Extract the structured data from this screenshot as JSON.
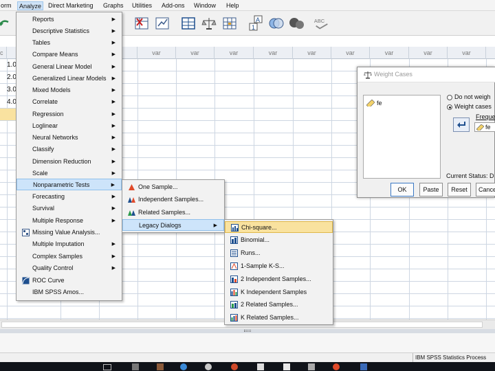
{
  "menubar": {
    "items": [
      "orm",
      "Analyze",
      "Direct Marketing",
      "Graphs",
      "Utilities",
      "Add-ons",
      "Window",
      "Help"
    ]
  },
  "grid": {
    "columns": [
      "c",
      "",
      "",
      "var",
      "var",
      "var",
      "var",
      "var",
      "var",
      "var",
      "var",
      "var",
      "var"
    ],
    "values": [
      "1.0",
      "2.0",
      "3.0",
      "4.0"
    ]
  },
  "analyze_menu": {
    "items": [
      {
        "label": "Reports",
        "arrow": true
      },
      {
        "label": "Descriptive Statistics",
        "arrow": true
      },
      {
        "label": "Tables",
        "arrow": true
      },
      {
        "label": "Compare Means",
        "arrow": true
      },
      {
        "label": "General Linear Model",
        "arrow": true
      },
      {
        "label": "Generalized Linear Models",
        "arrow": true
      },
      {
        "label": "Mixed Models",
        "arrow": true
      },
      {
        "label": "Correlate",
        "arrow": true
      },
      {
        "label": "Regression",
        "arrow": true
      },
      {
        "label": "Loglinear",
        "arrow": true
      },
      {
        "label": "Neural Networks",
        "arrow": true
      },
      {
        "label": "Classify",
        "arrow": true
      },
      {
        "label": "Dimension Reduction",
        "arrow": true
      },
      {
        "label": "Scale",
        "arrow": true
      },
      {
        "label": "Nonparametric Tests",
        "arrow": true
      },
      {
        "label": "Forecasting",
        "arrow": true
      },
      {
        "label": "Survival",
        "arrow": true
      },
      {
        "label": "Multiple Response",
        "arrow": true
      },
      {
        "label": "Missing Value Analysis...",
        "arrow": false
      },
      {
        "label": "Multiple Imputation",
        "arrow": true
      },
      {
        "label": "Complex Samples",
        "arrow": true
      },
      {
        "label": "Quality Control",
        "arrow": true
      },
      {
        "label": "ROC Curve",
        "arrow": false
      },
      {
        "label": "IBM SPSS Amos...",
        "arrow": false
      }
    ]
  },
  "nonparametric_menu": {
    "items": [
      {
        "label": "One Sample...",
        "arrow": false
      },
      {
        "label": "Independent Samples...",
        "arrow": false
      },
      {
        "label": "Related Samples...",
        "arrow": false
      },
      {
        "label": "Legacy Dialogs",
        "arrow": true
      }
    ]
  },
  "legacy_menu": {
    "items": [
      "Chi-square...",
      "Binomial...",
      "Runs...",
      "1-Sample K-S...",
      "2 Independent Samples...",
      "K Independent Samples",
      "2 Related Samples...",
      "K Related Samples..."
    ]
  },
  "dialog": {
    "title": "Weight Cases",
    "variable": "fe",
    "option_do_not": "Do not weigh",
    "option_weight": "Weight cases",
    "freq_label": "Freque",
    "freq_value": "fe",
    "current_status": "Current Status: D",
    "buttons": [
      "OK",
      "Paste",
      "Reset",
      "Cance"
    ]
  },
  "status": {
    "text": "IBM SPSS Statistics Process"
  },
  "colors": {
    "menu_highlight": "#cde4fa",
    "legacy_highlight": "#f9e29f",
    "taskbar": "#101319"
  }
}
